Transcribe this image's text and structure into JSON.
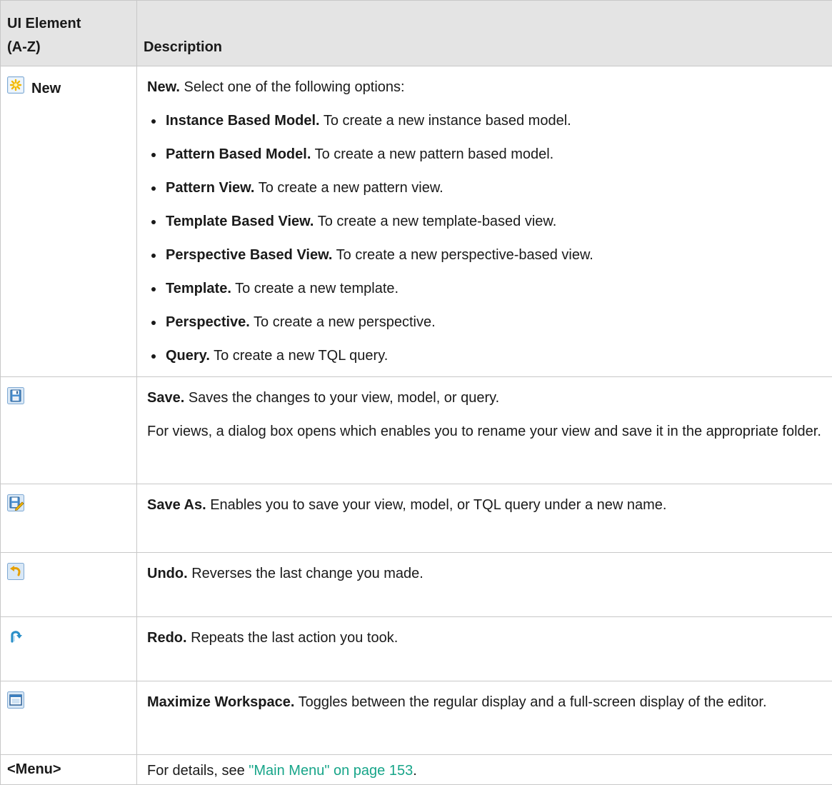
{
  "header": {
    "col1_line1": "UI Element",
    "col1_line2": "(A-Z)",
    "col2": "Description"
  },
  "rows": {
    "new": {
      "element_label": "New",
      "icon": "new-icon",
      "title": "New.",
      "text": " Select one of the following options:",
      "options": [
        {
          "title": "Instance Based Model.",
          "text": " To create a new instance based model."
        },
        {
          "title": "Pattern Based Model.",
          "text": " To create a new pattern based model."
        },
        {
          "title": "Pattern View.",
          "text": " To create a new pattern view."
        },
        {
          "title": "Template Based View.",
          "text": " To create a new template-based view."
        },
        {
          "title": "Perspective Based View.",
          "text": " To create a new perspective-based view."
        },
        {
          "title": "Template.",
          "text": " To create a new template."
        },
        {
          "title": "Perspective.",
          "text": " To create a new perspective."
        },
        {
          "title": "Query.",
          "text": " To create a new TQL query."
        }
      ]
    },
    "save": {
      "icon": "save-icon",
      "title": "Save.",
      "text": " Saves the changes to your view, model, or query.",
      "text2": "For views, a dialog box opens which enables you to rename your view and save it in the appropriate folder."
    },
    "save_as": {
      "icon": "save-as-icon",
      "title": "Save As.",
      "text": " Enables you to save your view, model, or TQL query under a new name."
    },
    "undo": {
      "icon": "undo-icon",
      "title": "Undo.",
      "text": " Reverses the last change you made."
    },
    "redo": {
      "icon": "redo-icon",
      "title": "Redo.",
      "text": " Repeats the last action you took."
    },
    "maximize": {
      "icon": "maximize-workspace-icon",
      "title": "Maximize Workspace.",
      "text": " Toggles between the regular display and a full-screen display of the editor."
    },
    "menu": {
      "element_label": "<Menu>",
      "text_before": "For details, see ",
      "link": "\"Main Menu\" on page 153",
      "text_after": "."
    }
  },
  "colors": {
    "header_bg": "#e4e4e4",
    "border": "#c8c8c8",
    "link": "#17a589",
    "icon_blue": "#3a7fc1"
  }
}
